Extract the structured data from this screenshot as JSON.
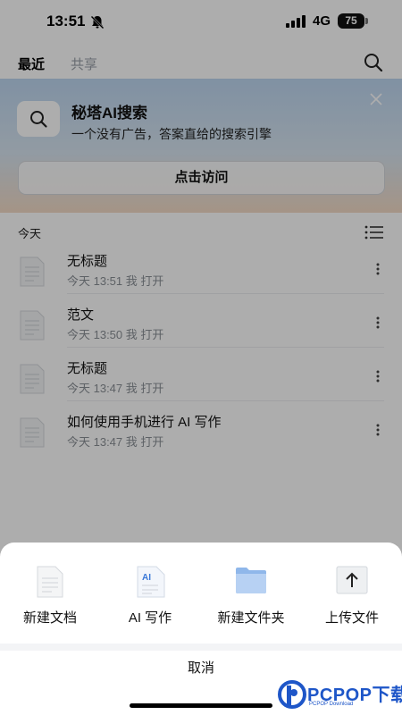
{
  "status_bar": {
    "time": "13:51",
    "network": "4G",
    "battery": "75"
  },
  "tabs": [
    {
      "label": "最近",
      "active": true
    },
    {
      "label": "共享",
      "active": false
    }
  ],
  "banner": {
    "title": "秘塔AI搜索",
    "subtitle": "一个没有广告，答案直给的搜索引擎",
    "button_label": "点击访问"
  },
  "section": {
    "label": "今天"
  },
  "documents": [
    {
      "title": "无标题",
      "meta": "今天 13:51 我 打开"
    },
    {
      "title": "范文",
      "meta": "今天 13:50 我 打开"
    },
    {
      "title": "无标题",
      "meta": "今天 13:47 我 打开"
    },
    {
      "title": "如何使用手机进行 AI 写作",
      "meta": "今天 13:47 我 打开"
    }
  ],
  "sheet": {
    "actions": [
      {
        "label": "新建文档",
        "icon": "document-icon"
      },
      {
        "label": "AI 写作",
        "icon": "ai-document-icon"
      },
      {
        "label": "新建文件夹",
        "icon": "folder-icon"
      },
      {
        "label": "上传文件",
        "icon": "upload-icon"
      }
    ],
    "cancel_label": "取消"
  },
  "watermark": {
    "brand": "PCPOP下载",
    "sub": "PCPOP Download"
  },
  "colors": {
    "accent": "#1e56c8",
    "banner_top": "#bdd6f0",
    "banner_bottom": "#f3dbc6",
    "meta_text": "#8a8f96"
  }
}
